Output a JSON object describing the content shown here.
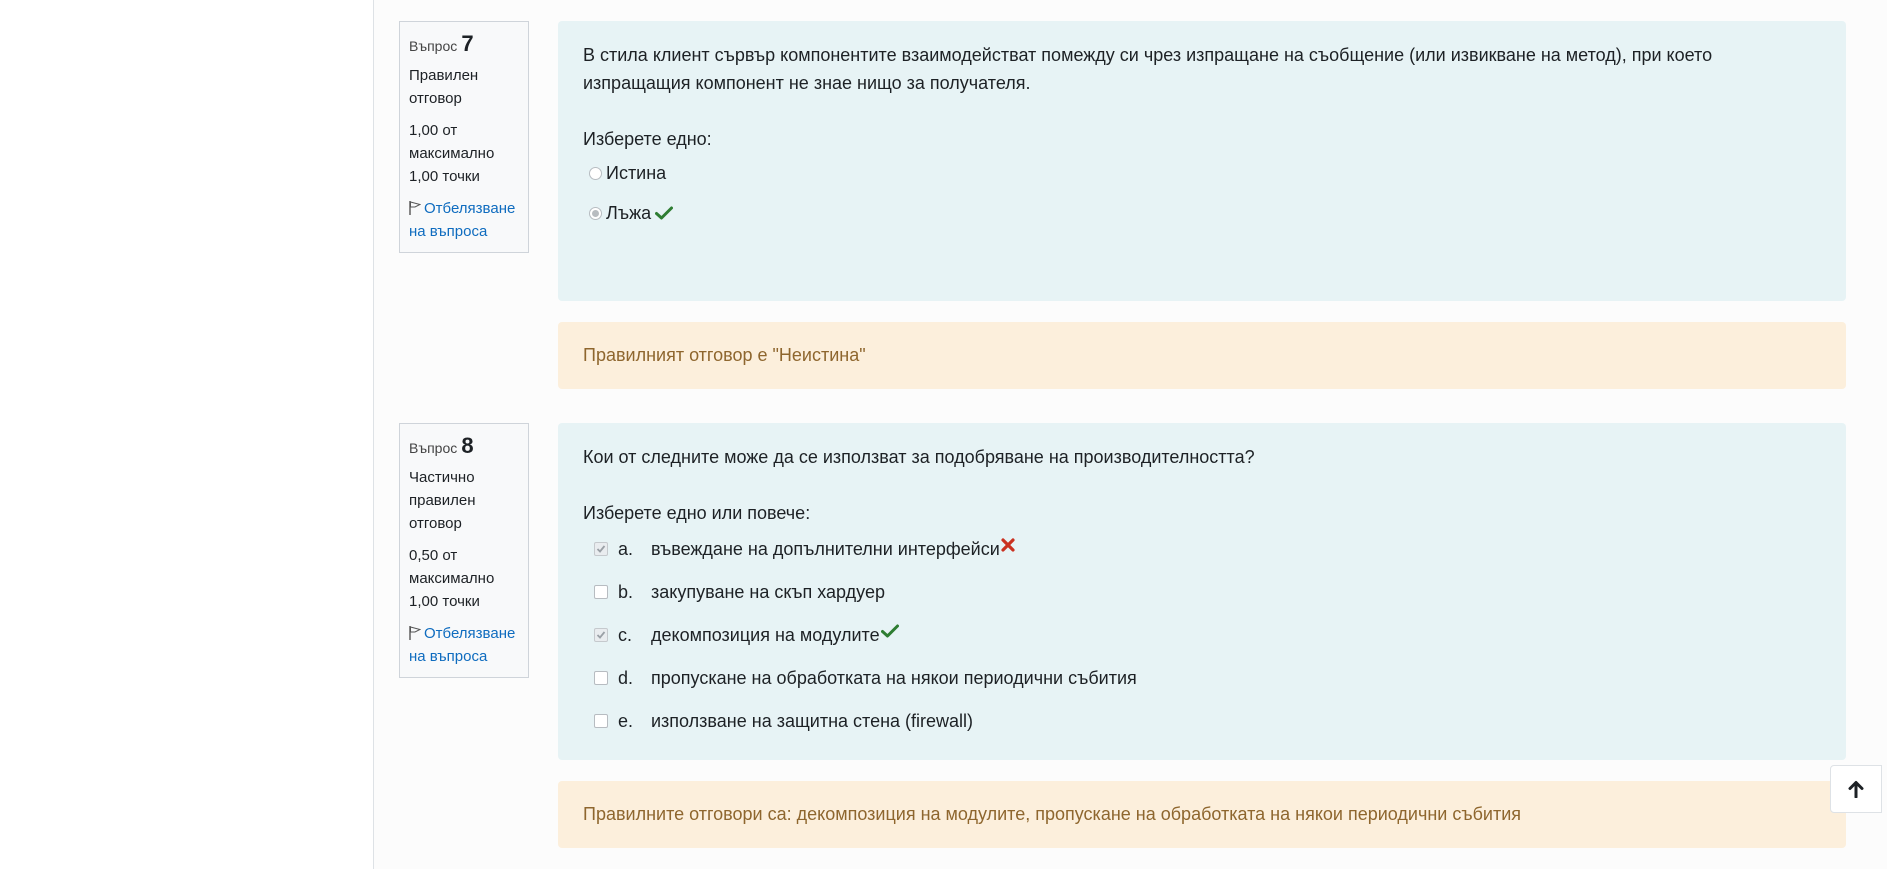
{
  "questions": [
    {
      "label": "Въпрос",
      "number": "7",
      "state": "Правилен отговор",
      "grade": "1,00 от максимално 1,00 точки",
      "flag_label": "Отбелязване на въпроса",
      "text": "В стила клиент сървър компонентите взаимодействат помежду си чрез изпращане на съобщение (или извикване на метод), при което изпращащия компонент не знае нищо за получателя.",
      "prompt": "Изберете едно:",
      "options": [
        {
          "label": "Истина",
          "selected": false
        },
        {
          "label": "Лъжа",
          "selected": true,
          "mark": "correct"
        }
      ],
      "feedback": "Правилният отговор е \"Неистина\""
    },
    {
      "label": "Въпрос",
      "number": "8",
      "state": "Частично правилен отговор",
      "grade": "0,50 от максимално 1,00 точки",
      "flag_label": "Отбелязване на въпроса",
      "text": "Кои от следните може да се използват за подобряване на производителността?",
      "prompt": "Изберете едно или повече:",
      "options": [
        {
          "letter": "a.",
          "label": "въвеждане на допълнителни интерфейси",
          "selected": true,
          "mark": "incorrect"
        },
        {
          "letter": "b.",
          "label": "закупуване на скъп хардуер",
          "selected": false
        },
        {
          "letter": "c.",
          "label": "декомпозиция на модулите",
          "selected": true,
          "mark": "correct"
        },
        {
          "letter": "d.",
          "label": "пропускане на обработката на някои периодични събития",
          "selected": false
        },
        {
          "letter": "e.",
          "label": "използване на защитна стена (firewall)",
          "selected": false
        }
      ],
      "feedback": "Правилните отговори са: декомпозиция на модулите, пропускане на обработката на някои периодични събития"
    }
  ],
  "colors": {
    "correct": "#2e7d32",
    "incorrect": "#ca3120",
    "content_bg": "#e7f3f5",
    "feedback_bg": "#fcefdc",
    "feedback_text": "#8e662e",
    "link": "#0f6cbf"
  },
  "icons": {
    "flag": "flag-icon",
    "correct": "check-icon",
    "incorrect": "cross-icon",
    "back_to_top": "arrow-up-icon"
  }
}
